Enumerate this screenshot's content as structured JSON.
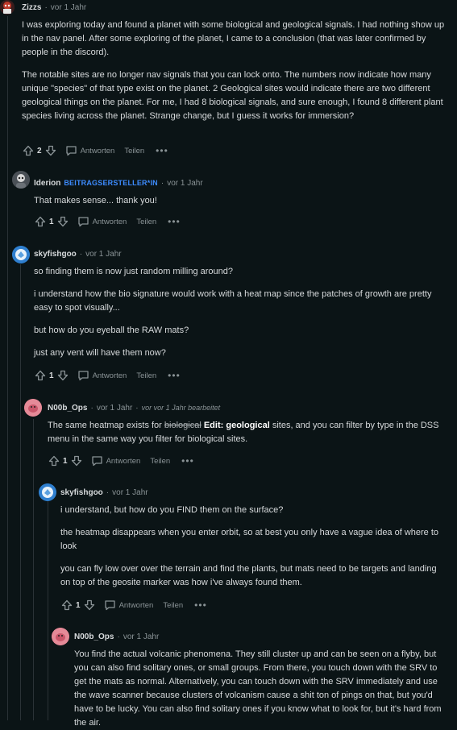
{
  "c1": {
    "author": "Zizzs",
    "time": "vor 1 Jahr",
    "paragraphs": [
      "I was exploring today and found a planet with some biological and geological signals. I had nothing show up in the nav panel. After some exploring of the planet, I came to a conclusion (that was later confirmed by people in the discord).",
      "The notable sites are no longer nav signals that you can lock onto. The numbers now indicate how many unique \"species\" of that type exist on the planet. 2 Geological sites would indicate there are two different geological things on the planet. For me, I had 8 biological signals, and sure enough, I found 8 different plant species living across the planet. Strange change, but I guess it works for immersion?"
    ],
    "score": "2",
    "reply": "Antworten",
    "share": "Teilen",
    "more": "•••"
  },
  "c2": {
    "author": "Iderion",
    "op_badge": "BEITRAGSERSTELLER*IN",
    "time": "vor 1 Jahr",
    "paragraphs": [
      "That makes sense... thank you!"
    ],
    "score": "1",
    "reply": "Antworten",
    "share": "Teilen",
    "more": "•••"
  },
  "c3": {
    "author": "skyfishgoo",
    "time": "vor 1 Jahr",
    "paragraphs": [
      "so finding them is now just random milling around?",
      "i understand how the bio signature would work with a heat map since the patches of growth are pretty easy to spot visually...",
      "but how do you eyeball the RAW mats?",
      "just any vent will have them now?"
    ],
    "score": "1",
    "reply": "Antworten",
    "share": "Teilen",
    "more": "•••"
  },
  "c4": {
    "author": "N00b_Ops",
    "time": "vor 1 Jahr",
    "edited": "vor vor 1 Jahr bearbeitet",
    "text_a": "The same heatmap exists for ",
    "strike": "biological",
    "bold_edit": "Edit",
    "text_b": ": ",
    "bold_geo": "geological",
    "text_c": " sites, and you can filter by type in the DSS menu in the same way you filter for biological sites.",
    "score": "1",
    "reply": "Antworten",
    "share": "Teilen",
    "more": "•••"
  },
  "c5": {
    "author": "skyfishgoo",
    "time": "vor 1 Jahr",
    "paragraphs": [
      "i understand, but how do you FIND them on the surface?",
      "the heatmap disappears when you enter orbit, so at best you only have a vague idea of where to look",
      "you can fly low over over the terrain and find the plants, but mats need to be targets and landing on top of the geosite marker was how i've always found them."
    ],
    "score": "1",
    "reply": "Antworten",
    "share": "Teilen",
    "more": "•••"
  },
  "c6": {
    "author": "N00b_Ops",
    "time": "vor 1 Jahr",
    "paragraphs": [
      "You find the actual volcanic phenomena. They still cluster up and can be seen on a flyby, but you can also find solitary ones, or small groups. From there, you touch down with the SRV to get the mats as normal. Alternatively, you can touch down with the SRV immediately and use the wave scanner because clusters of volcanism cause a shit ton of pings on that, but you'd have to be lucky. You can also find solitary ones if you know what to look for, but it's hard from the air."
    ]
  },
  "colors": {
    "background": "#0b1416",
    "op_badge": "#3d8cff",
    "thread_line": "#2a3236"
  }
}
